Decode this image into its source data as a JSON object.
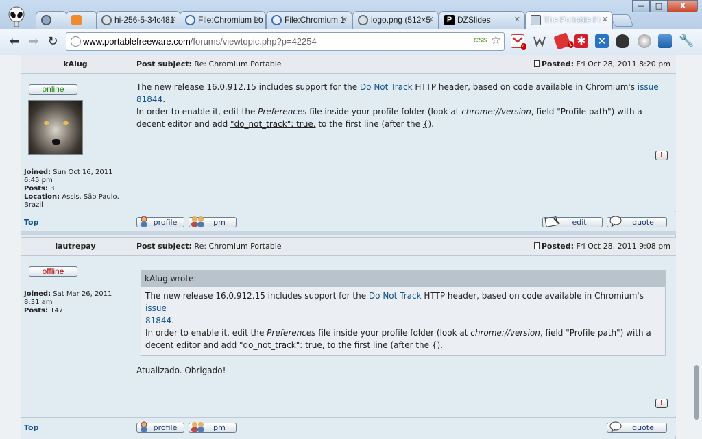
{
  "browser": {
    "tabs": [
      {
        "label": "",
        "icon": "chromium-icon"
      },
      {
        "label": "",
        "icon": "extension-icon"
      },
      {
        "label": "hi-256-5-34c481",
        "icon": "globe-icon"
      },
      {
        "label": "File:Chromium Lo",
        "icon": "wiki-icon"
      },
      {
        "label": "File:Chromium 1",
        "icon": "wiki-icon"
      },
      {
        "label": "logo.png (512×5",
        "icon": "globe-icon"
      },
      {
        "label": "DZSlides",
        "icon": "p-icon"
      },
      {
        "label": "The Portable Fr",
        "icon": "portable-icon"
      }
    ],
    "url_host": "www.portablefreeware.com",
    "url_path": "/forums/viewtopic.php?p=42254",
    "css_badge": "CSS",
    "gmail_badge": "4",
    "ext_badge": "1",
    "window_buttons": {
      "minimize": "—",
      "maximize": "□",
      "close": "X"
    }
  },
  "posts": [
    {
      "author": "kAlug",
      "subject_label": "Post subject:",
      "subject": "Re: Chromium Portable",
      "posted_label": "Posted:",
      "posted": "Fri Oct 28, 2011 8:20 pm",
      "status": "online",
      "joined_label": "Joined:",
      "joined": "Sun Oct 16, 2011 6:45 pm",
      "posts_label": "Posts:",
      "posts": "3",
      "location_label": "Location:",
      "location": "Assis, São Paulo, Brazil",
      "body": {
        "l1a": "The new release 16.0.912.15 includes support for the ",
        "l1link": "Do Not Track",
        "l1b": " HTTP header, based on code available in Chromium's ",
        "l1link2": "issue",
        "l2link": "81844",
        "l2b": ".",
        "l3a": "In order to enable it, edit the ",
        "l3i": "Preferences",
        "l3b": " file inside your profile folder (look at ",
        "l3i2": "chrome://version",
        "l3c": ", field \"Profile path\") with a",
        "l4a": "decent editor and add ",
        "l4u": "\"do_not_track\": true,",
        "l4b": " to the first line (after the ",
        "l4u2": "{",
        "l4c": ")."
      },
      "top_label": "Top",
      "buttons": {
        "profile": "profile",
        "pm": "pm",
        "edit": "edit",
        "quote": "quote"
      }
    },
    {
      "author": "lautrepay",
      "subject_label": "Post subject:",
      "subject": "Re: Chromium Portable",
      "posted_label": "Posted:",
      "posted": "Fri Oct 28, 2011 9:08 pm",
      "status": "offline",
      "joined_label": "Joined:",
      "joined": "Sat Mar 26, 2011 8:31 am",
      "posts_label": "Posts:",
      "posts": "147",
      "quote_head": "kAlug wrote:",
      "reply": "Atualizado. Obrigado!",
      "top_label": "Top",
      "buttons": {
        "profile": "profile",
        "pm": "pm",
        "quote": "quote"
      }
    }
  ],
  "report_glyph": "!"
}
